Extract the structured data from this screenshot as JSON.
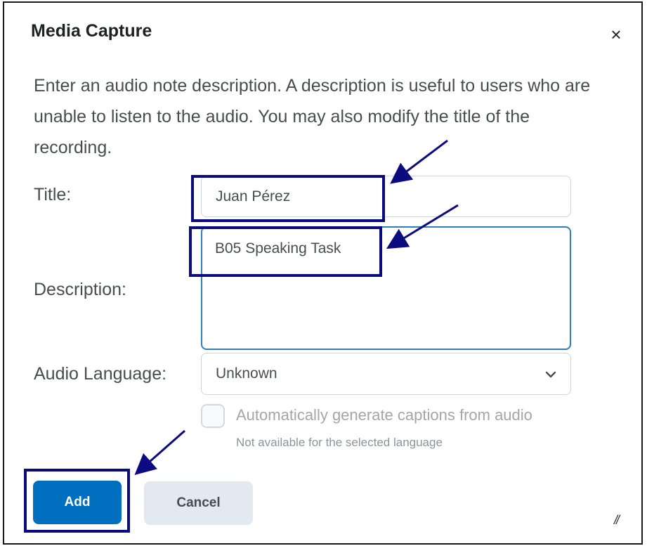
{
  "dialog": {
    "title": "Media Capture",
    "close_symbol": "×",
    "instructions": "Enter an audio note description. A description is useful to users who are unable to listen to the audio. You may also modify the title of the recording."
  },
  "form": {
    "title_label": "Title:",
    "title_value": "Juan Pérez",
    "description_label": "Description:",
    "description_value": "B05 Speaking Task",
    "language_label": "Audio Language:",
    "language_value": "Unknown",
    "captions_label": "Automatically generate captions from audio",
    "captions_note": "Not available for the selected language",
    "captions_checked": false
  },
  "buttons": {
    "add_label": "Add",
    "cancel_label": "Cancel"
  },
  "colors": {
    "primary": "#006fbf",
    "focus_border": "#2f7fba",
    "annotation": "#0b0a7e"
  }
}
